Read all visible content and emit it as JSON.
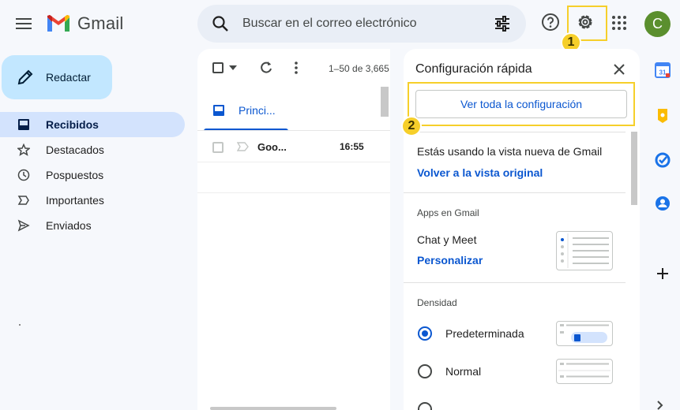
{
  "header": {
    "app_name": "Gmail",
    "search_placeholder": "Buscar en el correo electrónico",
    "avatar_initial": "C"
  },
  "annotations": {
    "badge1": "1",
    "badge2": "2",
    "highlight_color": "#f6cf2a"
  },
  "sidebar": {
    "compose_label": "Redactar",
    "items": [
      {
        "label": "Recibidos",
        "icon": "inbox-icon",
        "active": true
      },
      {
        "label": "Destacados",
        "icon": "star-icon",
        "active": false
      },
      {
        "label": "Pospuestos",
        "icon": "clock-icon",
        "active": false
      },
      {
        "label": "Importantes",
        "icon": "important-icon",
        "active": false
      },
      {
        "label": "Enviados",
        "icon": "send-icon",
        "active": false
      }
    ]
  },
  "mail": {
    "pager": "1–50 de 3,665",
    "tab_label": "Princi...",
    "rows": [
      {
        "sender": "Goo...",
        "time": "16:55"
      }
    ]
  },
  "quick_settings": {
    "title": "Configuración rápida",
    "see_all": "Ver toda la configuración",
    "view_text": "Estás usando la vista nueva de Gmail",
    "view_link": "Volver a la vista original",
    "apps_heading": "Apps en Gmail",
    "apps_text": "Chat y Meet",
    "apps_link": "Personalizar",
    "density_heading": "Densidad",
    "density_options": [
      {
        "label": "Predeterminada",
        "selected": true
      },
      {
        "label": "Normal",
        "selected": false
      }
    ]
  },
  "colors": {
    "accent": "#0b57d0",
    "compose_bg": "#c2e7ff",
    "active_nav": "#d3e3fd"
  }
}
